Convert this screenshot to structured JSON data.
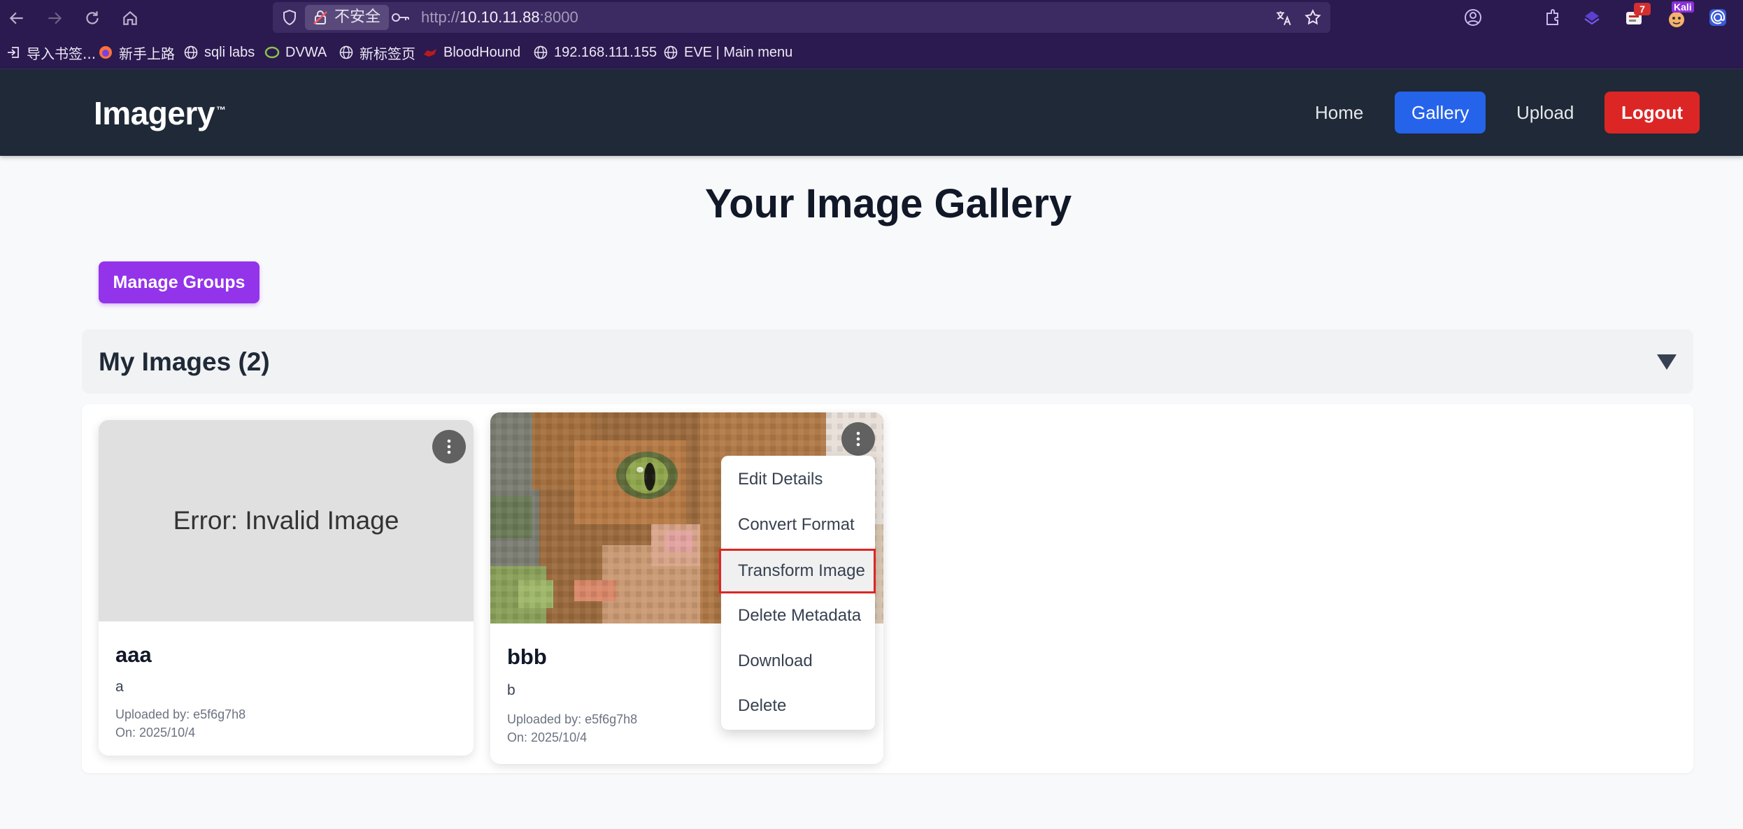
{
  "browser": {
    "insecure_label": "不安全",
    "url_prefix": "http://",
    "url_host": "10.10.11.88",
    "url_port": ":8000",
    "extension_badge_count": "7",
    "profile_label": "Kali",
    "icons": [
      "back-icon",
      "forward-icon",
      "reload-icon",
      "home-icon",
      "shield-icon",
      "lock-warning-icon",
      "key-icon",
      "translate-icon",
      "star-icon"
    ]
  },
  "bookmarks": [
    {
      "label": "导入书签...",
      "icon": "import-icon"
    },
    {
      "label": "新手上路",
      "icon": "firefox-icon"
    },
    {
      "label": "sqli labs",
      "icon": "globe-icon"
    },
    {
      "label": "DVWA",
      "icon": "dvwa-icon"
    },
    {
      "label": "新标签页",
      "icon": "globe-icon"
    },
    {
      "label": "BloodHound",
      "icon": "bloodhound-icon"
    },
    {
      "label": "192.168.111.155",
      "icon": "globe-icon"
    },
    {
      "label": "EVE | Main menu",
      "icon": "globe-icon"
    }
  ],
  "site": {
    "brand": "Imagery",
    "brand_tm": "™",
    "nav": {
      "home": "Home",
      "gallery": "Gallery",
      "upload": "Upload",
      "logout": "Logout"
    },
    "colors": {
      "header_bg": "#1f2937",
      "gallery_active": "#2563eb",
      "logout": "#dc2626",
      "manage_groups": "#9333ea",
      "menu_highlight_border": "#dc2626"
    }
  },
  "main": {
    "page_title": "Your Image Gallery",
    "manage_groups_label": "Manage Groups",
    "section_title": "My Images (2)",
    "cards": [
      {
        "thumb_text": "Error: Invalid Image",
        "title": "aaa",
        "description": "a",
        "uploaded_by": "Uploaded by: e5f6g7h8",
        "date": "On: 2025/10/4"
      },
      {
        "title": "bbb",
        "description": "b",
        "uploaded_by": "Uploaded by: e5f6g7h8",
        "date": "On: 2025/10/4"
      }
    ],
    "context_menu": {
      "items": [
        "Edit Details",
        "Convert Format",
        "Transform Image",
        "Delete Metadata",
        "Download",
        "Delete"
      ],
      "highlighted": "Transform Image"
    }
  }
}
